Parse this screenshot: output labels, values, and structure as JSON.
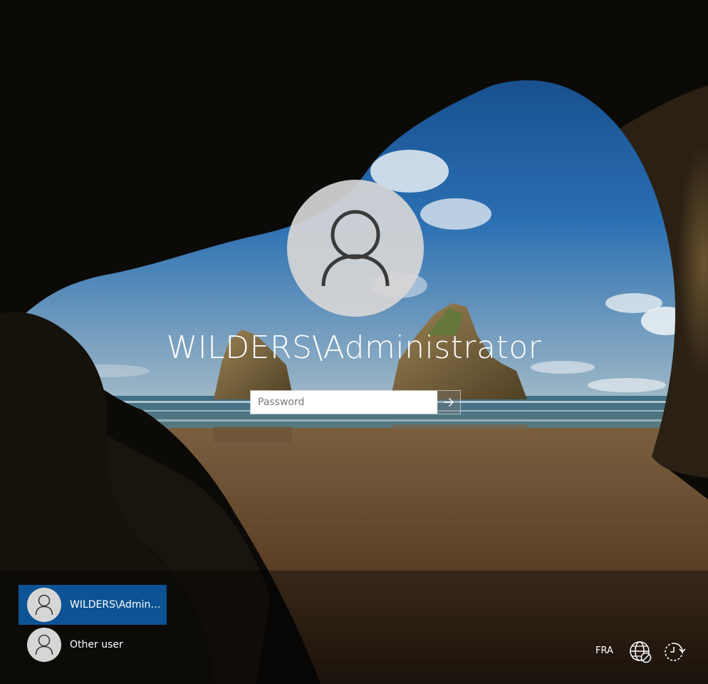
{
  "login": {
    "username": "WILDERS\\Administrator",
    "password_placeholder": "Password"
  },
  "user_list": [
    {
      "label": "WILDERS\\Administrator",
      "display": "WILDERS\\Admini...",
      "selected": true
    },
    {
      "label": "Other user",
      "display": "Other user",
      "selected": false
    }
  ],
  "system_tray": {
    "language": "FRA",
    "network_icon": "network-disconnected-icon",
    "ease_of_access_icon": "ease-of-access-icon"
  },
  "colors": {
    "selected_tile": "#0b5394",
    "avatar_bg": "#d6d6d6",
    "text": "#ffffff"
  }
}
